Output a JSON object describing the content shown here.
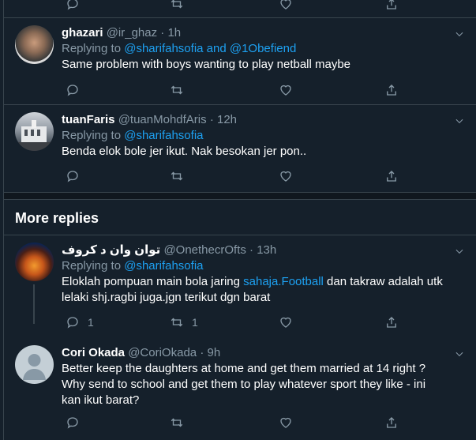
{
  "top_actions": {},
  "tweets": [
    {
      "name": "ghazari",
      "handle": "@ir_ghaz",
      "time": "1h",
      "replying_prefix": "Replying to",
      "replying_to": "@sharifahsofia and @1Obefiend",
      "text": "Same problem with boys wanting to play netball maybe",
      "reply_count": "",
      "retweet_count": ""
    },
    {
      "name": "tuanFaris",
      "handle": "@tuanMohdfAris",
      "time": "12h",
      "replying_prefix": "Replying to",
      "replying_to": "@sharifahsofia",
      "text": "Benda elok bole jer ikut. Nak besokan jer pon..",
      "reply_count": "",
      "retweet_count": ""
    },
    {
      "name": "توان وان د كروف",
      "handle": "@OnethecrOfts",
      "time": "13h",
      "replying_prefix": "Replying to",
      "replying_to": "@sharifahsofia",
      "text_before": "Eloklah pompuan main bola jaring ",
      "text_link": "sahaja.Football",
      "text_after": " dan takraw adalah utk lelaki shj.ragbi juga.jgn terikut dgn  barat",
      "reply_count": "1",
      "retweet_count": "1"
    },
    {
      "name": "Cori Okada",
      "handle": "@CoriOkada",
      "time": "9h",
      "text": "Better keep the daughters at home and get them married at 14 right ? Why send to school and get them to play whatever sport they like - ini kan ikut barat?",
      "reply_count": "",
      "retweet_count": ""
    }
  ],
  "section": {
    "more_replies": "More replies"
  },
  "separator_dot": "·",
  "icons": [
    "reply-icon",
    "retweet-icon",
    "like-icon",
    "share-icon",
    "chevron-down-icon"
  ],
  "colors": {
    "background": "#15202b",
    "border": "#38444d",
    "muted": "#8899a6",
    "link": "#1da1f2"
  }
}
